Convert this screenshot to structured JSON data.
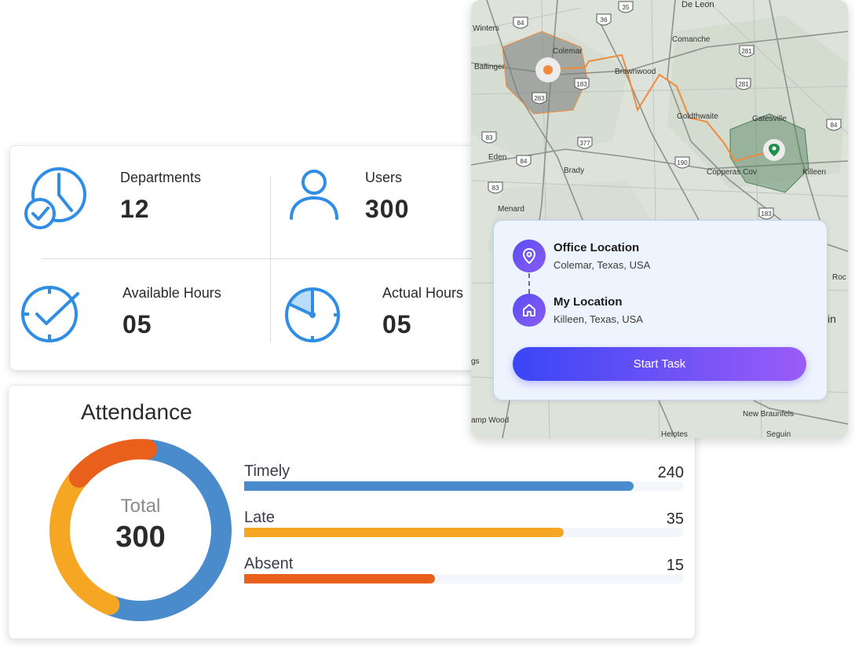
{
  "stats": {
    "departments": {
      "label": "Departments",
      "value": "12"
    },
    "users": {
      "label": "Users",
      "value": "300"
    },
    "available_hours": {
      "label": "Available Hours",
      "value": "05"
    },
    "actual_hours": {
      "label": "Actual Hours",
      "value": "05"
    }
  },
  "attendance": {
    "title": "Attendance",
    "total_label": "Total",
    "total_value": "300",
    "items": [
      {
        "label": "Timely",
        "value": 240,
        "color": "#4a8bcb"
      },
      {
        "label": "Late",
        "value": 35,
        "color": "#f5a623"
      },
      {
        "label": "Absent",
        "value": 15,
        "color": "#e8601c"
      }
    ]
  },
  "map": {
    "places": [
      "De Leon",
      "Winters",
      "Colemar",
      "Comanche",
      "Ballinger",
      "Brownwood",
      "Goldthwaite",
      "Gatesville",
      "Eden",
      "Brady",
      "Copperas Cov",
      "Killeen",
      "Menard",
      "New Braunfels",
      "amp Wood",
      "Seguin",
      "Helotes",
      "gs",
      "Roc",
      "in"
    ],
    "roads": [
      "84",
      "36",
      "281",
      "183",
      "377",
      "190",
      "84",
      "83",
      "83",
      "183",
      "283",
      "281",
      "84",
      "35"
    ],
    "office": {
      "title": "Office Location",
      "address": "Colemar, Texas, USA"
    },
    "mine": {
      "title": "My Location",
      "address": "Killeen, Texas, USA"
    },
    "start_button": "Start Task",
    "colors": {
      "route": "#f08a3c",
      "office_zone": "#7a7a7a",
      "my_zone": "#4f7f5b",
      "accent": "#5b4df0"
    }
  }
}
